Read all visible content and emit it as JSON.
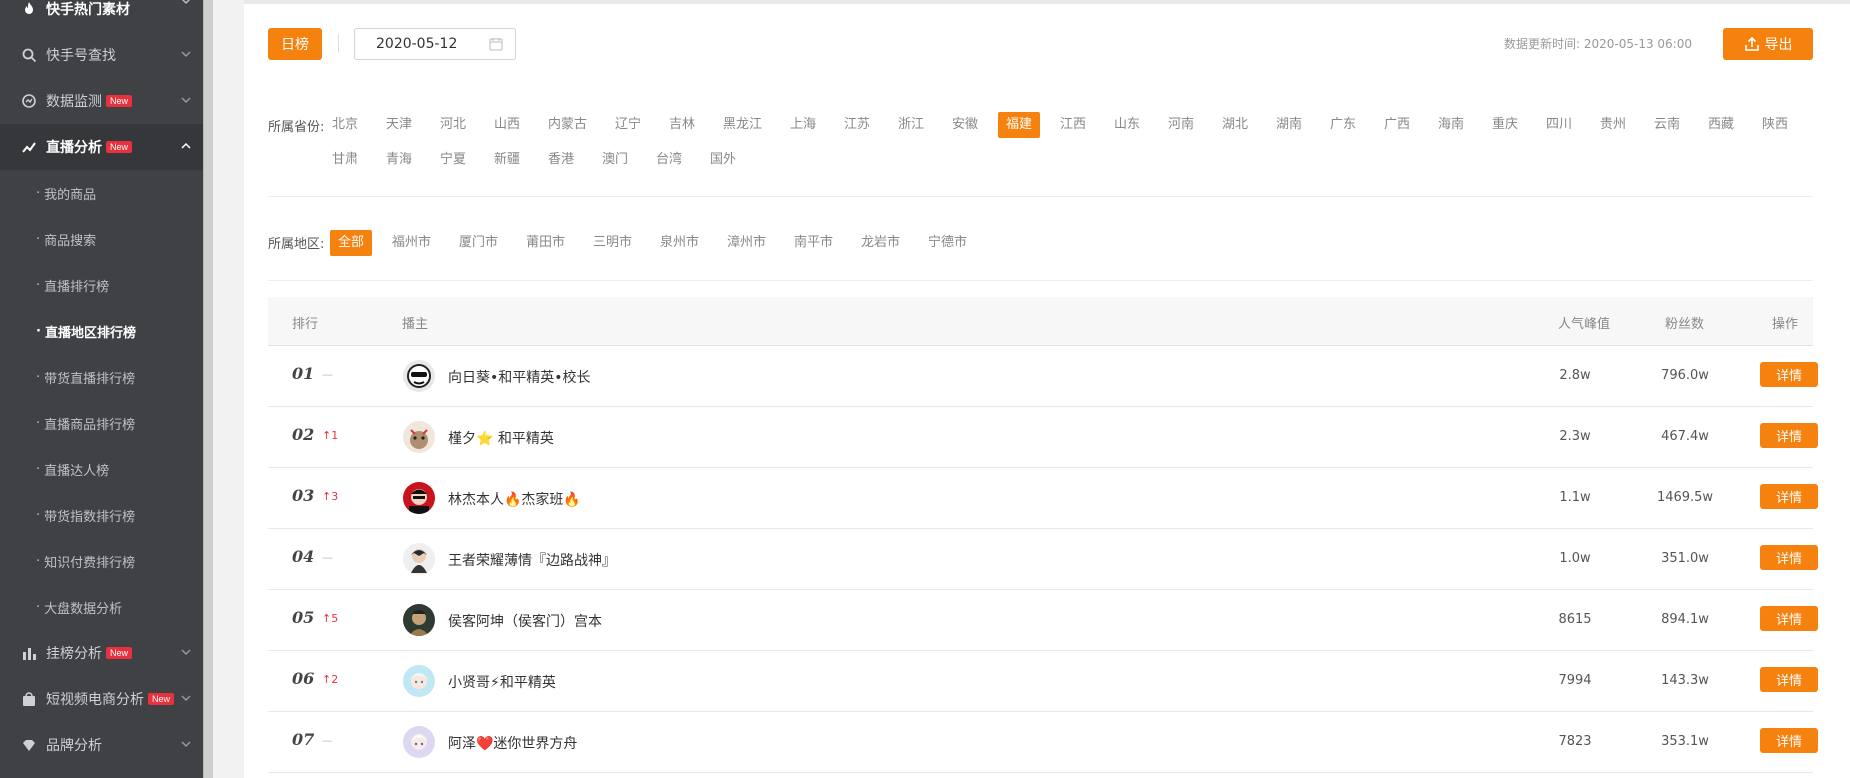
{
  "sidebar": {
    "top_items": [
      {
        "label": "快手热门素材",
        "icon": "fire-icon"
      },
      {
        "label": "快手号查找",
        "icon": "search-icon"
      },
      {
        "label": "数据监测",
        "icon": "monitor-icon",
        "badge": "New"
      },
      {
        "label": "直播分析",
        "icon": "trend-icon",
        "badge": "New",
        "expanded": true
      }
    ],
    "sub_items": [
      {
        "label": "我的商品"
      },
      {
        "label": "商品搜索"
      },
      {
        "label": "直播排行榜"
      },
      {
        "label": "直播地区排行榜",
        "active": true
      },
      {
        "label": "带货直播排行榜"
      },
      {
        "label": "直播商品排行榜"
      },
      {
        "label": "直播达人榜"
      },
      {
        "label": "带货指数排行榜"
      },
      {
        "label": "知识付费排行榜"
      },
      {
        "label": "大盘数据分析"
      }
    ],
    "bottom_items": [
      {
        "label": "挂榜分析",
        "icon": "bar-chart-icon",
        "badge": "New"
      },
      {
        "label": "短视频电商分析",
        "icon": "shopping-bag-icon",
        "badge": "New"
      },
      {
        "label": "品牌分析",
        "icon": "diamond-icon"
      }
    ],
    "sub_bullet": "·"
  },
  "toolbar": {
    "daily_label": "日榜",
    "date_value": "2020-05-12",
    "update_label": "数据更新时间: 2020-05-13 06:00",
    "export_label": "导出"
  },
  "filters": {
    "province_label": "所属省份:",
    "provinces_row1": [
      "北京",
      "天津",
      "河北",
      "山西",
      "内蒙古",
      "辽宁",
      "吉林",
      "黑龙江",
      "上海",
      "江苏",
      "浙江",
      "安徽",
      "福建",
      "江西",
      "山东",
      "河南",
      "湖北",
      "湖南",
      "广东",
      "广西",
      "海南",
      "重庆",
      "四川",
      "贵州",
      "云南",
      "西藏",
      "陕西"
    ],
    "provinces_row2": [
      "甘肃",
      "青海",
      "宁夏",
      "新疆",
      "香港",
      "澳门",
      "台湾",
      "国外"
    ],
    "selected_province": "福建",
    "region_label": "所属地区:",
    "regions": [
      "全部",
      "福州市",
      "厦门市",
      "莆田市",
      "三明市",
      "泉州市",
      "漳州市",
      "南平市",
      "龙岩市",
      "宁德市"
    ],
    "selected_region": "全部"
  },
  "table": {
    "headers": {
      "rank": "排行",
      "anchor": "播主",
      "peak": "人气峰值",
      "fans": "粉丝数",
      "action": "操作"
    },
    "rows": [
      {
        "rank": "01",
        "change": "—",
        "dir": "flat",
        "name": "向日葵•和平精英•校长",
        "peak": "2.8w",
        "fans": "796.0w",
        "action": "详情"
      },
      {
        "rank": "02",
        "change": "↑1",
        "dir": "up",
        "name": "槿夕⭐ 和平精英",
        "peak": "2.3w",
        "fans": "467.4w",
        "action": "详情"
      },
      {
        "rank": "03",
        "change": "↑3",
        "dir": "up",
        "name": "林杰本人🔥杰家班🔥",
        "peak": "1.1w",
        "fans": "1469.5w",
        "action": "详情"
      },
      {
        "rank": "04",
        "change": "—",
        "dir": "flat",
        "name": "王者荣耀薄情『边路战神』",
        "peak": "1.0w",
        "fans": "351.0w",
        "action": "详情"
      },
      {
        "rank": "05",
        "change": "↑5",
        "dir": "up",
        "name": "侯客阿坤（侯客门）宫本",
        "peak": "8615",
        "fans": "894.1w",
        "action": "详情"
      },
      {
        "rank": "06",
        "change": "↑2",
        "dir": "up",
        "name": "小贤哥⚡和平精英",
        "peak": "7994",
        "fans": "143.3w",
        "action": "详情"
      },
      {
        "rank": "07",
        "change": "—",
        "dir": "flat",
        "name": "阿泽❤️迷你世界方舟",
        "peak": "7823",
        "fans": "353.1w",
        "action": "详情"
      }
    ]
  },
  "colors": {
    "accent": "#f5810f",
    "up": "#e8313d",
    "sidebar_bg": "#3f4145"
  }
}
